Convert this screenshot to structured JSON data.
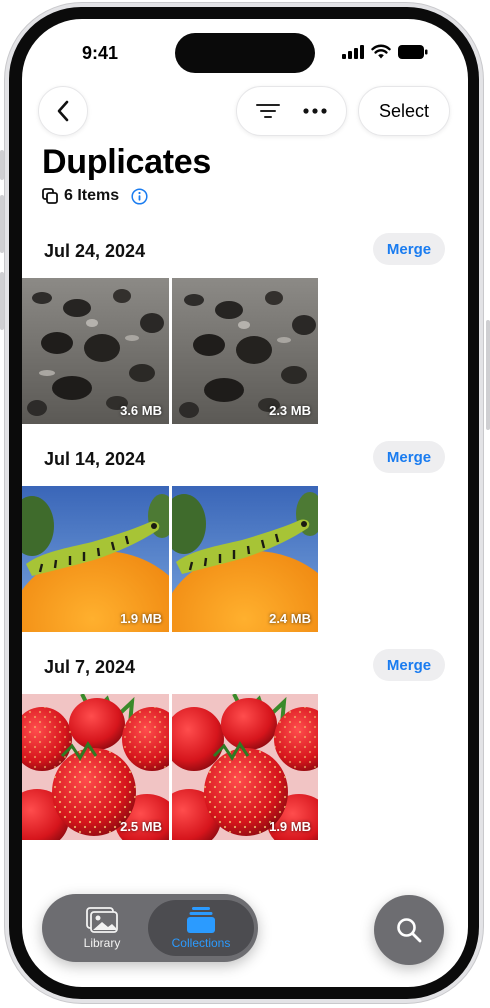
{
  "status_bar": {
    "time": "9:41"
  },
  "nav": {
    "select_label": "Select"
  },
  "page": {
    "title": "Duplicates",
    "item_count": "6 Items"
  },
  "groups": [
    {
      "date": "Jul 24, 2024",
      "merge_label": "Merge",
      "photos": [
        {
          "subject": "volcanic rock",
          "size": "3.6 MB"
        },
        {
          "subject": "volcanic rock",
          "size": "2.3 MB"
        }
      ]
    },
    {
      "date": "Jul 14, 2024",
      "merge_label": "Merge",
      "photos": [
        {
          "subject": "caterpillar on fruit",
          "size": "1.9 MB"
        },
        {
          "subject": "caterpillar on fruit",
          "size": "2.4 MB"
        }
      ]
    },
    {
      "date": "Jul 7, 2024",
      "merge_label": "Merge",
      "photos": [
        {
          "subject": "strawberries",
          "size": "2.5 MB"
        },
        {
          "subject": "strawberries",
          "size": "1.9 MB"
        }
      ]
    }
  ],
  "tabbar": {
    "library_label": "Library",
    "collections_label": "Collections",
    "active": "Collections"
  },
  "colors": {
    "accent": "#1a7cf0",
    "tab_active": "#2b9bff",
    "tabbar_bg": "#6d6d71"
  }
}
